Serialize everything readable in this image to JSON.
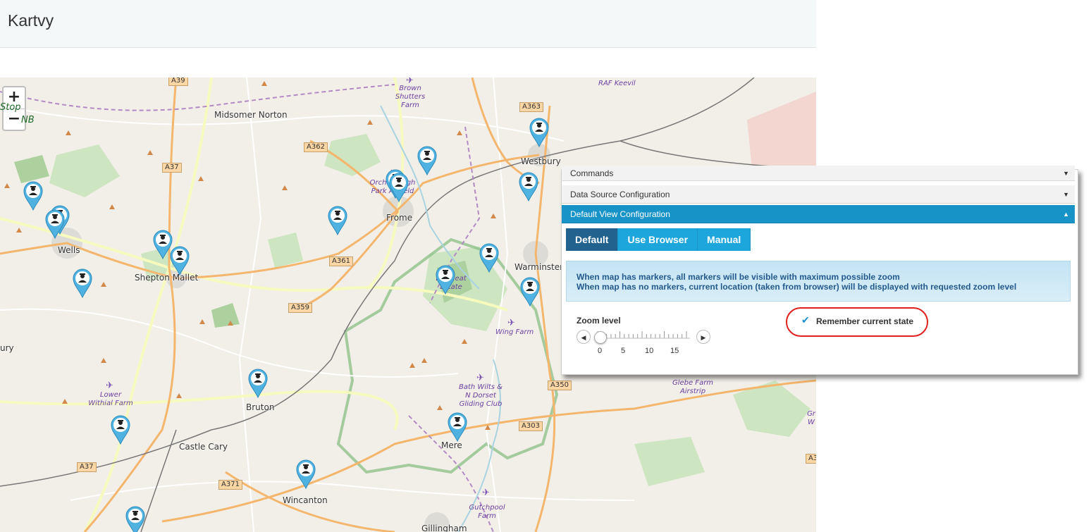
{
  "page": {
    "title": "Kartvy"
  },
  "map": {
    "zoom_in": "+",
    "zoom_out": "−",
    "place_labels": [
      "Midsomer Norton",
      "Westbury",
      "Frome",
      "Wells",
      "Shepton Mallet",
      "Warminster",
      "Bruton",
      "Castle Cary",
      "Wincanton",
      "Gillingham",
      "Mere"
    ],
    "poi_labels": [
      "Brown Shutters Farm",
      "RAF Keevil",
      "Orchardleigh Park Airfield",
      "Longleat Estate",
      "Wing Farm",
      "Lower Withial Farm",
      "Bath Wilts & N Dorset Gliding Club",
      "Gutchpool Farm",
      "Glebe Farm Airstrip"
    ],
    "green_labels": [
      "Stop",
      "NB"
    ],
    "roads": [
      "A39",
      "A363",
      "A362",
      "A37",
      "A361",
      "A359",
      "A350",
      "A303",
      "A37",
      "A371",
      "A3"
    ],
    "partial_labels": [
      "ury",
      "Gr W"
    ]
  },
  "panel": {
    "sections": {
      "commands": "Commands",
      "data_source": "Data Source Configuration",
      "default_view": "Default View Configuration"
    },
    "modes": [
      "Default",
      "Use Browser",
      "Manual"
    ],
    "selected_mode": "Default",
    "info_line1": "When map has markers, all markers will be visible with maximum possible zoom",
    "info_line2": "When map has no markers, current location (taken from browser) will be displayed with requested zoom level",
    "zoom_label": "Zoom level",
    "zoom_value": 0,
    "zoom_ticks": [
      "0",
      "5",
      "10",
      "15"
    ],
    "remember_label": "Remember current state",
    "remember_checked": true
  }
}
